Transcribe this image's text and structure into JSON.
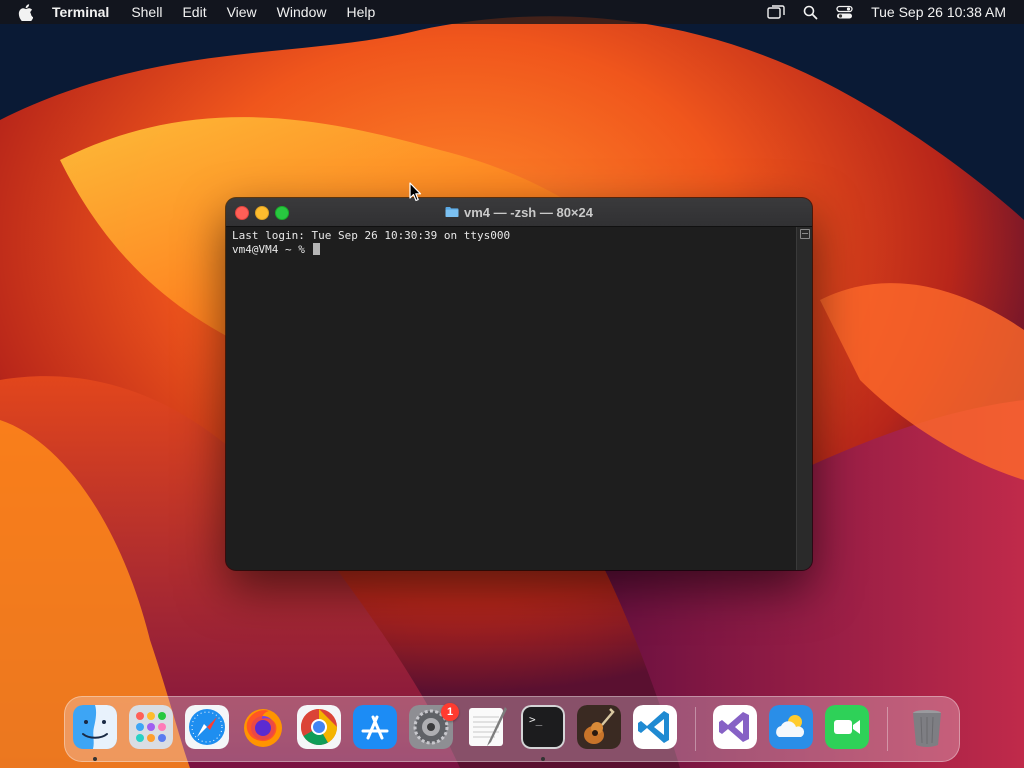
{
  "menubar": {
    "app_name": "Terminal",
    "items": [
      "Shell",
      "Edit",
      "View",
      "Window",
      "Help"
    ],
    "clock": "Tue Sep 26  10:38 AM"
  },
  "terminal": {
    "title": "vm4 — -zsh — 80×24",
    "lines": [
      "Last login: Tue Sep 26 10:30:39 on ttys000",
      "vm4@VM4 ~ % "
    ]
  },
  "dock": {
    "apps": [
      {
        "name": "Finder",
        "icon": "finder-icon",
        "running": true
      },
      {
        "name": "Launchpad",
        "icon": "launchpad-icon",
        "running": false
      },
      {
        "name": "Safari",
        "icon": "safari-icon",
        "running": false
      },
      {
        "name": "Firefox",
        "icon": "firefox-icon",
        "running": false
      },
      {
        "name": "Google Chrome",
        "icon": "chrome-icon",
        "running": false
      },
      {
        "name": "App Store",
        "icon": "app-store-icon",
        "running": false
      },
      {
        "name": "System Settings",
        "icon": "system-settings-icon",
        "running": false,
        "badge": "1"
      },
      {
        "name": "TextEdit",
        "icon": "textedit-icon",
        "running": false
      },
      {
        "name": "Terminal",
        "icon": "terminal-icon",
        "running": true
      },
      {
        "name": "GarageBand",
        "icon": "garageband-icon",
        "running": false
      },
      {
        "name": "Visual Studio Code",
        "icon": "vscode-icon",
        "running": false
      },
      {
        "name": "Visual Studio",
        "icon": "visual-studio-icon",
        "running": false
      },
      {
        "name": "Weather",
        "icon": "weather-icon",
        "running": false
      },
      {
        "name": "FaceTime",
        "icon": "facetime-icon",
        "running": false
      },
      {
        "name": "Trash",
        "icon": "trash-icon",
        "running": false
      }
    ]
  },
  "colors": {
    "close": "#ff5f57",
    "minimize": "#febc2e",
    "maximize": "#28c840",
    "terminal_bg": "#1e1e1e"
  }
}
